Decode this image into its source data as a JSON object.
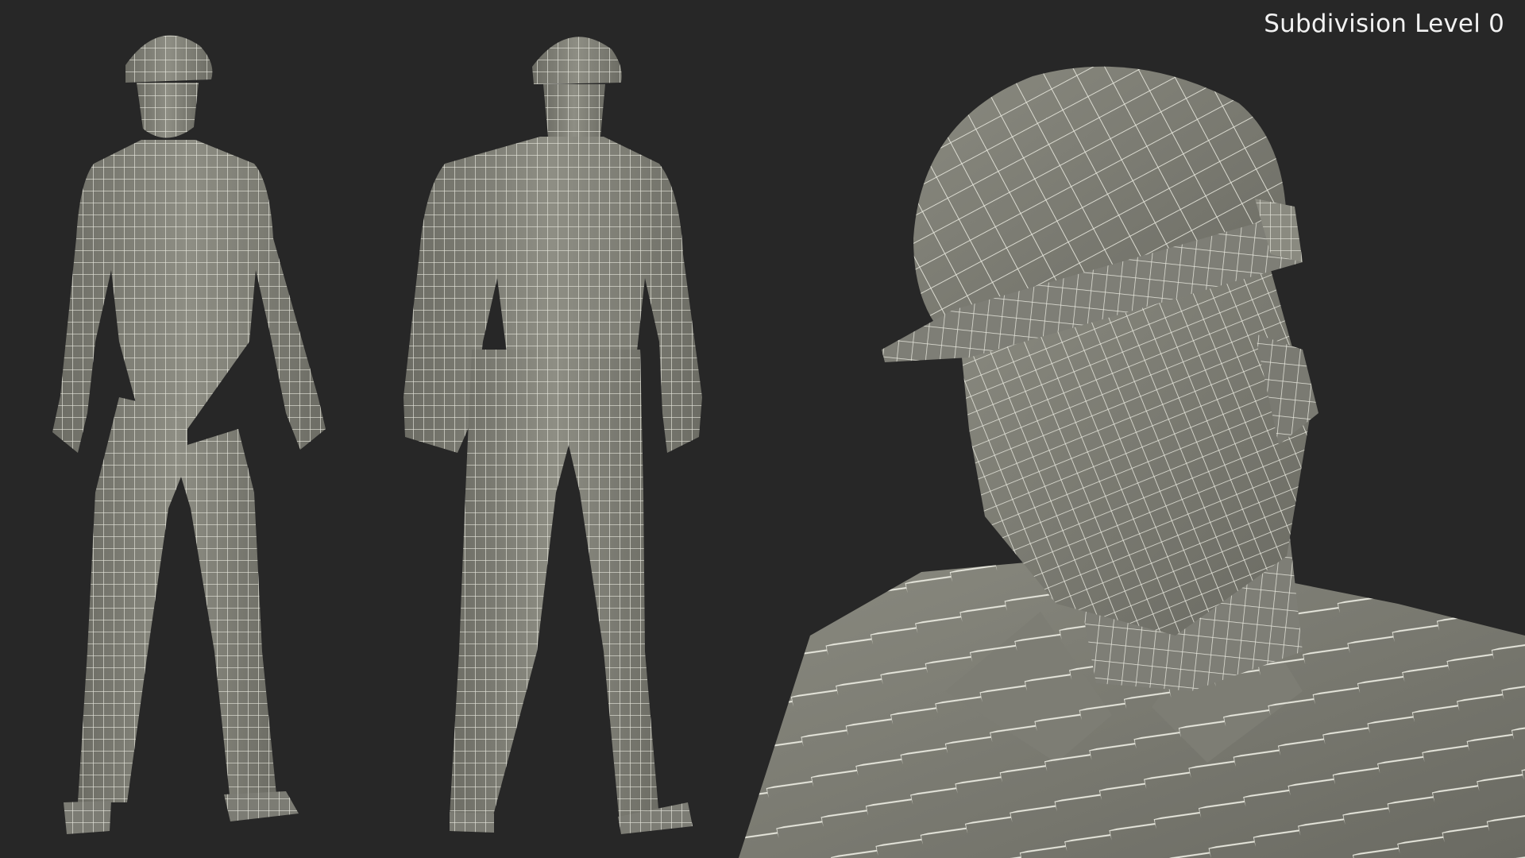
{
  "viewport": {
    "caption": "Subdivision Level 0"
  },
  "colors": {
    "background": "#272727",
    "mesh_fill": "#8a8a80",
    "mesh_shade": "#6f6f67",
    "wire": "#e6e6dc",
    "caption_text": "#f2f2f2"
  },
  "views": [
    {
      "id": "front-view"
    },
    {
      "id": "back-view"
    },
    {
      "id": "head-closeup"
    }
  ]
}
